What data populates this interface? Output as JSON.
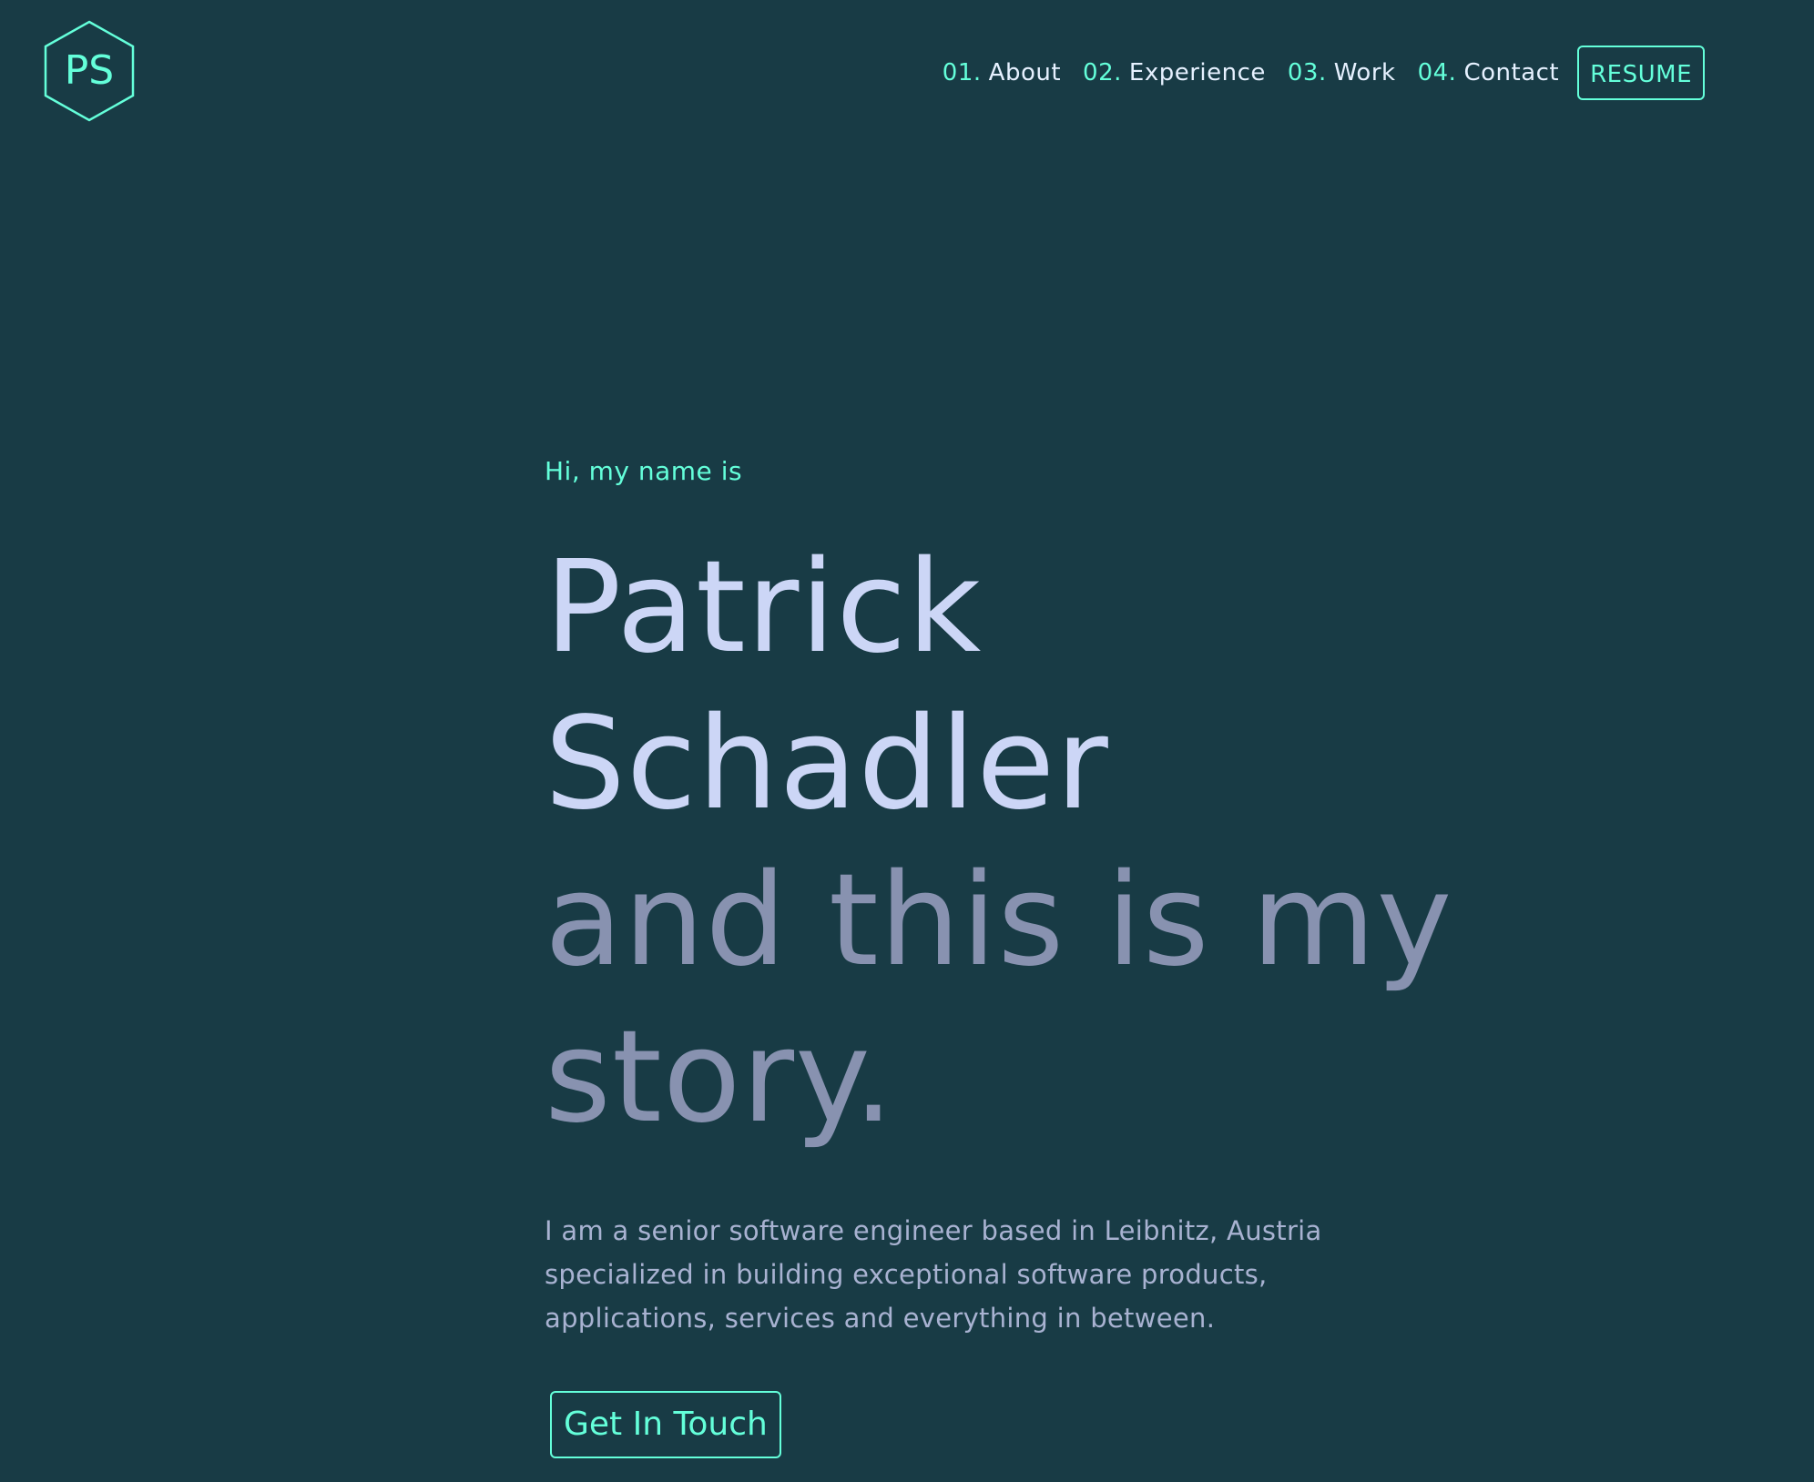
{
  "brand": {
    "logo_text": "PS",
    "logo_icon": "hexagon-logo",
    "accent": "#64ffda",
    "background": "#183b45"
  },
  "nav": {
    "items": [
      {
        "num": "01.",
        "label": "About"
      },
      {
        "num": "02.",
        "label": "Experience"
      },
      {
        "num": "03.",
        "label": "Work"
      },
      {
        "num": "04.",
        "label": "Contact"
      }
    ],
    "resume_label": "RESUME"
  },
  "hero": {
    "intro": "Hi, my name is",
    "name_line_1": "Patrick",
    "name_line_2": "Schadler",
    "tagline_line_1": "and this is my",
    "tagline_line_2": "story.",
    "bio_line_1": "I am a senior software engineer based in Leibnitz, Austria",
    "bio_line_2": "specialized in building exceptional software products,",
    "bio_line_3": "applications, services and everything in between.",
    "cta_label": "Get In Touch"
  },
  "colors": {
    "heading": "#ccd6f6",
    "subheading": "#8892b0",
    "body_text": "#a8b2d1",
    "nav_text": "#e6f1ff"
  }
}
